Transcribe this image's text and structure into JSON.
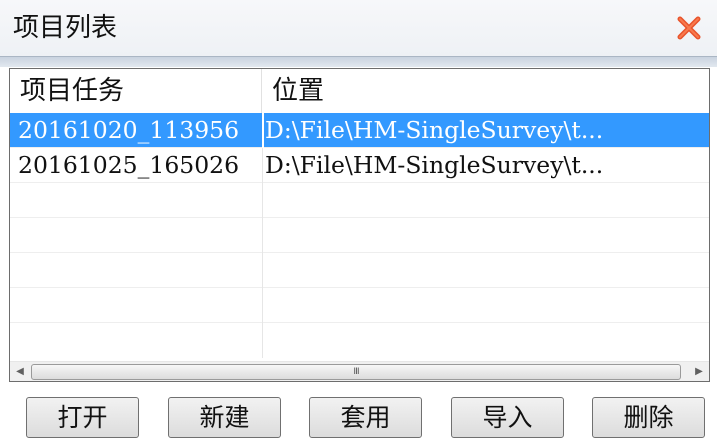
{
  "window": {
    "title": "项目列表",
    "close_icon": "close-x-icon",
    "close_color": "#e8532b"
  },
  "list": {
    "columns": [
      "项目任务",
      "位置"
    ],
    "rows": [
      {
        "task": "20161020_113956",
        "location": "D:\\File\\HM-SingleSurvey\\t...",
        "selected": true
      },
      {
        "task": "20161025_165026",
        "location": "D:\\File\\HM-SingleSurvey\\t...",
        "selected": false
      }
    ],
    "selection_color": "#3399ff"
  },
  "scrollbar": {
    "left_icon": "scroll-left-arrow-icon",
    "right_icon": "scroll-right-arrow-icon",
    "grip": "Ⅲ"
  },
  "buttons": {
    "open": "打开",
    "new": "新建",
    "apply": "套用",
    "import": "导入",
    "delete": "删除"
  }
}
